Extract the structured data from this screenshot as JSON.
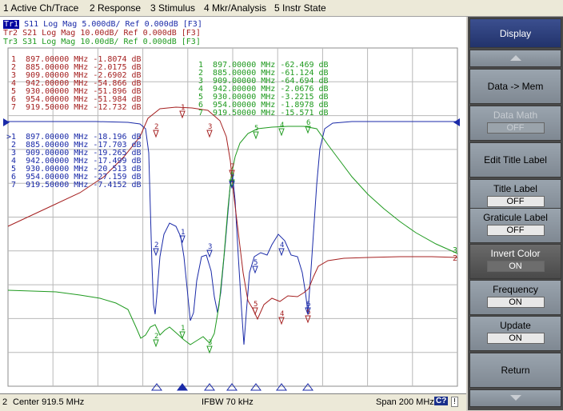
{
  "menu": [
    "1 Active Ch/Trace",
    "2 Response",
    "3 Stimulus",
    "4 Mkr/Analysis",
    "5 Instr State"
  ],
  "traces": [
    {
      "id": "Tr1",
      "text": "S11 Log Mag 5.000dB/ Ref 0.000dB [F3]",
      "color": "#1a2aa8"
    },
    {
      "id": "Tr2",
      "text": "S21 Log Mag 10.00dB/ Ref 0.000dB [F3]",
      "color": "#a52020"
    },
    {
      "id": "Tr3",
      "text": "S31 Log Mag 10.00dB/ Ref 0.000dB [F3]",
      "color": "#1f9a1f"
    }
  ],
  "markers": {
    "tr2": [
      "1  897.00000 MHz -1.8074 dB",
      "2  885.00000 MHz -2.0175 dB",
      "3  909.00000 MHz -2.6902 dB",
      "4  942.00000 MHz -54.866 dB",
      "5  930.00000 MHz -51.896 dB",
      "6  954.00000 MHz -51.984 dB",
      "7  919.50000 MHz -12.732 dB"
    ],
    "tr3": [
      "1  897.00000 MHz -62.469 dB",
      "2  885.00000 MHz -61.124 dB",
      "3  909.00000 MHz -64.694 dB",
      "4  942.00000 MHz -2.0676 dB",
      "5  930.00000 MHz -3.2215 dB",
      "6  954.00000 MHz -1.8978 dB",
      "7  919.50000 MHz -15.571 dB"
    ],
    "tr1": [
      ">1  897.00000 MHz -18.196 dB",
      " 2  885.00000 MHz -17.703 dB",
      " 3  909.00000 MHz -19.265 dB",
      " 4  942.00000 MHz -17.499 dB",
      " 5  930.00000 MHz -20.513 dB",
      " 6  954.00000 MHz -27.159 dB",
      " 7  919.50000 MHz -7.4152 dB"
    ]
  },
  "trace_end_labels": {
    "tr3": "3",
    "tr2": "2"
  },
  "status": {
    "channel": "2",
    "center": "Center 919.5 MHz",
    "ifbw": "IFBW 70 kHz",
    "span": "Span 200 MHz",
    "cal_badge": "C?",
    "warning": "!"
  },
  "softkeys": {
    "title": "Display",
    "data_mem": "Data -> Mem",
    "data_math": {
      "label": "Data Math",
      "value": "OFF"
    },
    "edit_title": "Edit Title Label",
    "title_label": {
      "label": "Title Label",
      "value": "OFF"
    },
    "graticule_label": {
      "label": "Graticule Label",
      "value": "OFF"
    },
    "invert_color": {
      "label": "Invert Color",
      "value": "ON"
    },
    "frequency": {
      "label": "Frequency",
      "value": "ON"
    },
    "update": {
      "label": "Update",
      "value": "ON"
    },
    "return": "Return"
  },
  "colors": {
    "tr1": "#1a2aa8",
    "tr2": "#a52020",
    "tr3": "#1f9a1f",
    "grid": "#b8b8b8"
  }
}
